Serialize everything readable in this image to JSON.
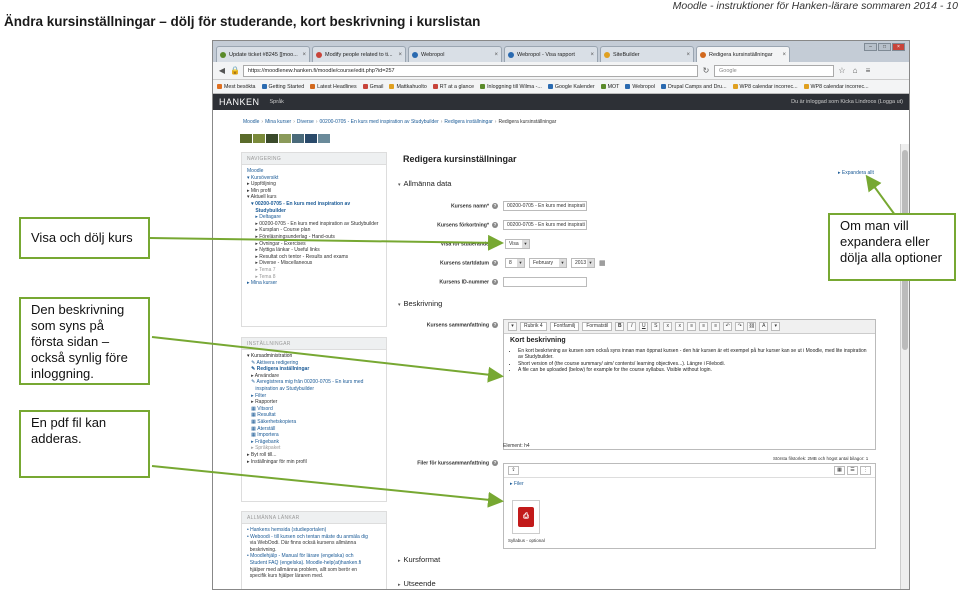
{
  "slide": {
    "title": "Ändra kursinställningar – dölj för studerande, kort beskrivning i kurslistan",
    "header": "Moodle - instruktioner för Hanken-lärare sommaren 2014 - 10"
  },
  "callouts": {
    "visa": "Visa och dölj kurs",
    "beskrivning": "Den beskrivning som syns på första sidan – också synlig före inloggning.",
    "pdf": "En pdf fil kan adderas.",
    "expandera": "Om man vill expandera eller dölja alla optioner"
  },
  "browser": {
    "tabs": [
      {
        "label": "Update ticket #8245 [[moo...",
        "icon_color": "#5a8a2a"
      },
      {
        "label": "Modify people related to ti...",
        "icon_color": "#c8443a"
      },
      {
        "label": "Webropol",
        "icon_color": "#2a6ab0"
      },
      {
        "label": "Webropol - Visa rapport",
        "icon_color": "#2a6ab0"
      },
      {
        "label": "SiteBuilder",
        "icon_color": "#e0a020"
      },
      {
        "label": "Redigera kursinställningar",
        "icon_color": "#d2691e"
      }
    ],
    "url": "https://moodlenew.hanken.fi/moodle/course/edit.php?id=257",
    "search_placeholder": "Google",
    "bookmarks": [
      "Mest besökta",
      "Getting Started",
      "Latest Headlines",
      "Gmail",
      "Mattkahuolto",
      "RT at a glance",
      "Inloggning till Wilma -...",
      "Google Kalender",
      "MOT",
      "Webropol",
      "Drupal Camps and Dru...",
      "WP8 calendar incorrec...",
      "WP8 calendar incorrec..."
    ],
    "site": {
      "logo": "HANKEN",
      "language": "Språk",
      "login_text": "Du är inloggad som Kicka Lindroos (Logga ut)"
    },
    "breadcrumb": [
      "Moodle",
      "Mina kurser",
      "Diverse",
      "00200-0705 - En kurs med inspiration av Studybuilder",
      "Redigera inställningar",
      "Redigera kursinställningar"
    ],
    "swatches": [
      "#5a6b2a",
      "#7a8a3a",
      "#3a4a2a",
      "#8a9a5a",
      "#4a6a7a",
      "#2a4a6a",
      "#6a8a9a"
    ],
    "nav_block": {
      "header": "NAVIGERING",
      "items": [
        {
          "text": "Moodle",
          "style": "link"
        },
        {
          "text": "▾ Kursöversikt",
          "style": "link"
        },
        {
          "text": "▸ Uppföljning",
          "style": "plain"
        },
        {
          "text": "▸ Min profil",
          "style": "plain"
        },
        {
          "text": "▾ Aktuell kurs",
          "style": "plain"
        },
        {
          "text": "   ▾ 00200-0705 - En kurs med inspiration av",
          "style": "linkbold"
        },
        {
          "text": "      Studybuilder",
          "style": "linkbold"
        },
        {
          "text": "      ▸ Deltagare",
          "style": "link"
        },
        {
          "text": "      ▸ 00200-0705 - En kurs med inspiration av Studybuilder",
          "style": "plain"
        },
        {
          "text": "      ▸ Kursplan - Course plan",
          "style": "plain"
        },
        {
          "text": "      ▸ Föreläsningsunderlag - Hand-outs",
          "style": "plain"
        },
        {
          "text": "      ▸ Övningar - Exercises",
          "style": "plain"
        },
        {
          "text": "      ▸ Nyttiga länkar - Useful links",
          "style": "plain"
        },
        {
          "text": "      ▸ Resultat och tentor - Results and exams",
          "style": "plain"
        },
        {
          "text": "      ▸ Diverse - Miscellaneous",
          "style": "plain"
        },
        {
          "text": "      ▸ Tema 7",
          "style": "gray"
        },
        {
          "text": "      ▸ Tema 8",
          "style": "gray"
        },
        {
          "text": "▸ Mina kurser",
          "style": "link"
        }
      ]
    },
    "settings_block": {
      "header": "INSTÄLLNINGAR",
      "items": [
        {
          "text": "▾ Kursadministration",
          "style": "dark"
        },
        {
          "text": "   ✎ Aktivera redigering",
          "style": "link"
        },
        {
          "text": "   ✎ Redigera inställningar",
          "style": "linkbold"
        },
        {
          "text": "   ▸ Användare",
          "style": "plain"
        },
        {
          "text": "   ✎ Avregistrera mig från 00200-0705 - En kurs med",
          "style": "link"
        },
        {
          "text": "      inspiration av Studybuilder",
          "style": "link"
        },
        {
          "text": "   ▸ Filter",
          "style": "link"
        },
        {
          "text": "   ▸ Rapporter",
          "style": "plain"
        },
        {
          "text": "   ▦ Vitsord",
          "style": "link"
        },
        {
          "text": "   ▦ Resultat",
          "style": "link"
        },
        {
          "text": "   ▦ Säkerhetskopiera",
          "style": "link"
        },
        {
          "text": "   ▦ Återställ",
          "style": "link"
        },
        {
          "text": "   ▦ Importera",
          "style": "link"
        },
        {
          "text": "   ▸ Frågebank",
          "style": "link"
        },
        {
          "text": "   ▸ Språkpaket",
          "style": "gray"
        },
        {
          "text": "▸ Byt roll till...",
          "style": "plain"
        },
        {
          "text": "▸ Inställningar för min profil",
          "style": "plain"
        }
      ]
    },
    "links_block": {
      "header": "ALLMÄNNA LÄNKAR",
      "items": [
        {
          "text": "• Hankens hemsida (studieportalen)",
          "style": "link"
        },
        {
          "text": "• Weboodi - till kursen och tentan måste du anmäla dig",
          "style": "link"
        },
        {
          "text": "  via WebOodi. Där finns också kursens allmänna",
          "style": "plain"
        },
        {
          "text": "  beskrivning.",
          "style": "plain"
        },
        {
          "text": "• Moodlehjälp - Manual för lärare (engelska) och",
          "style": "link"
        },
        {
          "text": "  Student FAQ (engelska). Moodle-help(at)hanken.fi",
          "style": "link"
        },
        {
          "text": "  hjälper med allmänna problem, allt som berör en",
          "style": "plain"
        },
        {
          "text": "  specifik kurs hjälper läraren med.",
          "style": "plain"
        }
      ]
    },
    "form": {
      "page_title": "Redigera kursinställningar",
      "expand_all": "Expandera allt",
      "section_general": "Allmänna data",
      "section_description": "Beskrivning",
      "section_format": "Kursformat",
      "section_appearance": "Utseende",
      "fullname_label": "Kursens namn*",
      "fullname_value": "00200-0705 - En kurs med inspirati",
      "shortname_label": "Kursens förkortning*",
      "shortname_value": "00200-0705 - En kurs med inspirati",
      "visible_label": "Visa för studerande",
      "visible_value": "Visa",
      "startdate_label": "Kursens startdatum",
      "start_day": "8",
      "start_month": "February",
      "start_year": "2013",
      "idnumber_label": "Kursens ID-nummer",
      "summary_label": "Kursens sammanfattning",
      "files_label": "Filer för kurssammanfattning",
      "editor": {
        "font_size": "Rubrik 4",
        "font_family": "Fontfamilj",
        "format": "Formatstil",
        "heading": "Kort beskrivning",
        "bullets": [
          "En kort beskrivning av kursen som också syns innan man öppnat kursen - den här kursen är ett exempel på hur kurser kan se ut i Moodle, med lite inspiration av Studybuilder.",
          "Short version of (the course summary/ aim/ contents/ learning objectives...). Längre i Filebodi.",
          "A file can be uploaded (below) for example for the course syllabus. Visible without login."
        ],
        "path": "Element: h4"
      },
      "file_limits": "Största filstorlek: 2MB och högst antal bilagor: 1",
      "files_path": "▸ Filer",
      "pdf_name": "Syllabus - optional"
    }
  }
}
